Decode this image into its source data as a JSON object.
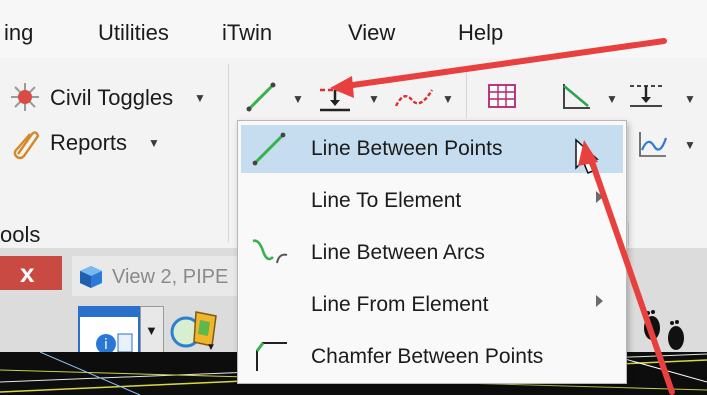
{
  "menubar": {
    "items": [
      "ing",
      "Utilities",
      "iTwin",
      "View",
      "Help"
    ]
  },
  "ribbon": {
    "civil_toggles_label": "Civil Toggles",
    "reports_label": "Reports",
    "group_label": "ools"
  },
  "dropdown": {
    "items": [
      {
        "label": "Line Between Points",
        "icon": "line-between-points-icon",
        "highlighted": true,
        "submenu": false
      },
      {
        "label": "Line To Element",
        "icon": "",
        "highlighted": false,
        "submenu": true
      },
      {
        "label": "Line Between Arcs",
        "icon": "line-between-arcs-icon",
        "highlighted": false,
        "submenu": false
      },
      {
        "label": "Line From Element",
        "icon": "",
        "highlighted": false,
        "submenu": true
      },
      {
        "label": "Chamfer Between Points",
        "icon": "chamfer-icon",
        "highlighted": false,
        "submenu": false
      }
    ]
  },
  "view": {
    "tab_label": "View 2, PIPE",
    "close_glyph": "x"
  },
  "colors": {
    "highlight": "#c6dcef",
    "annotation_arrow": "#e8403e",
    "close_button": "#c94a43"
  }
}
